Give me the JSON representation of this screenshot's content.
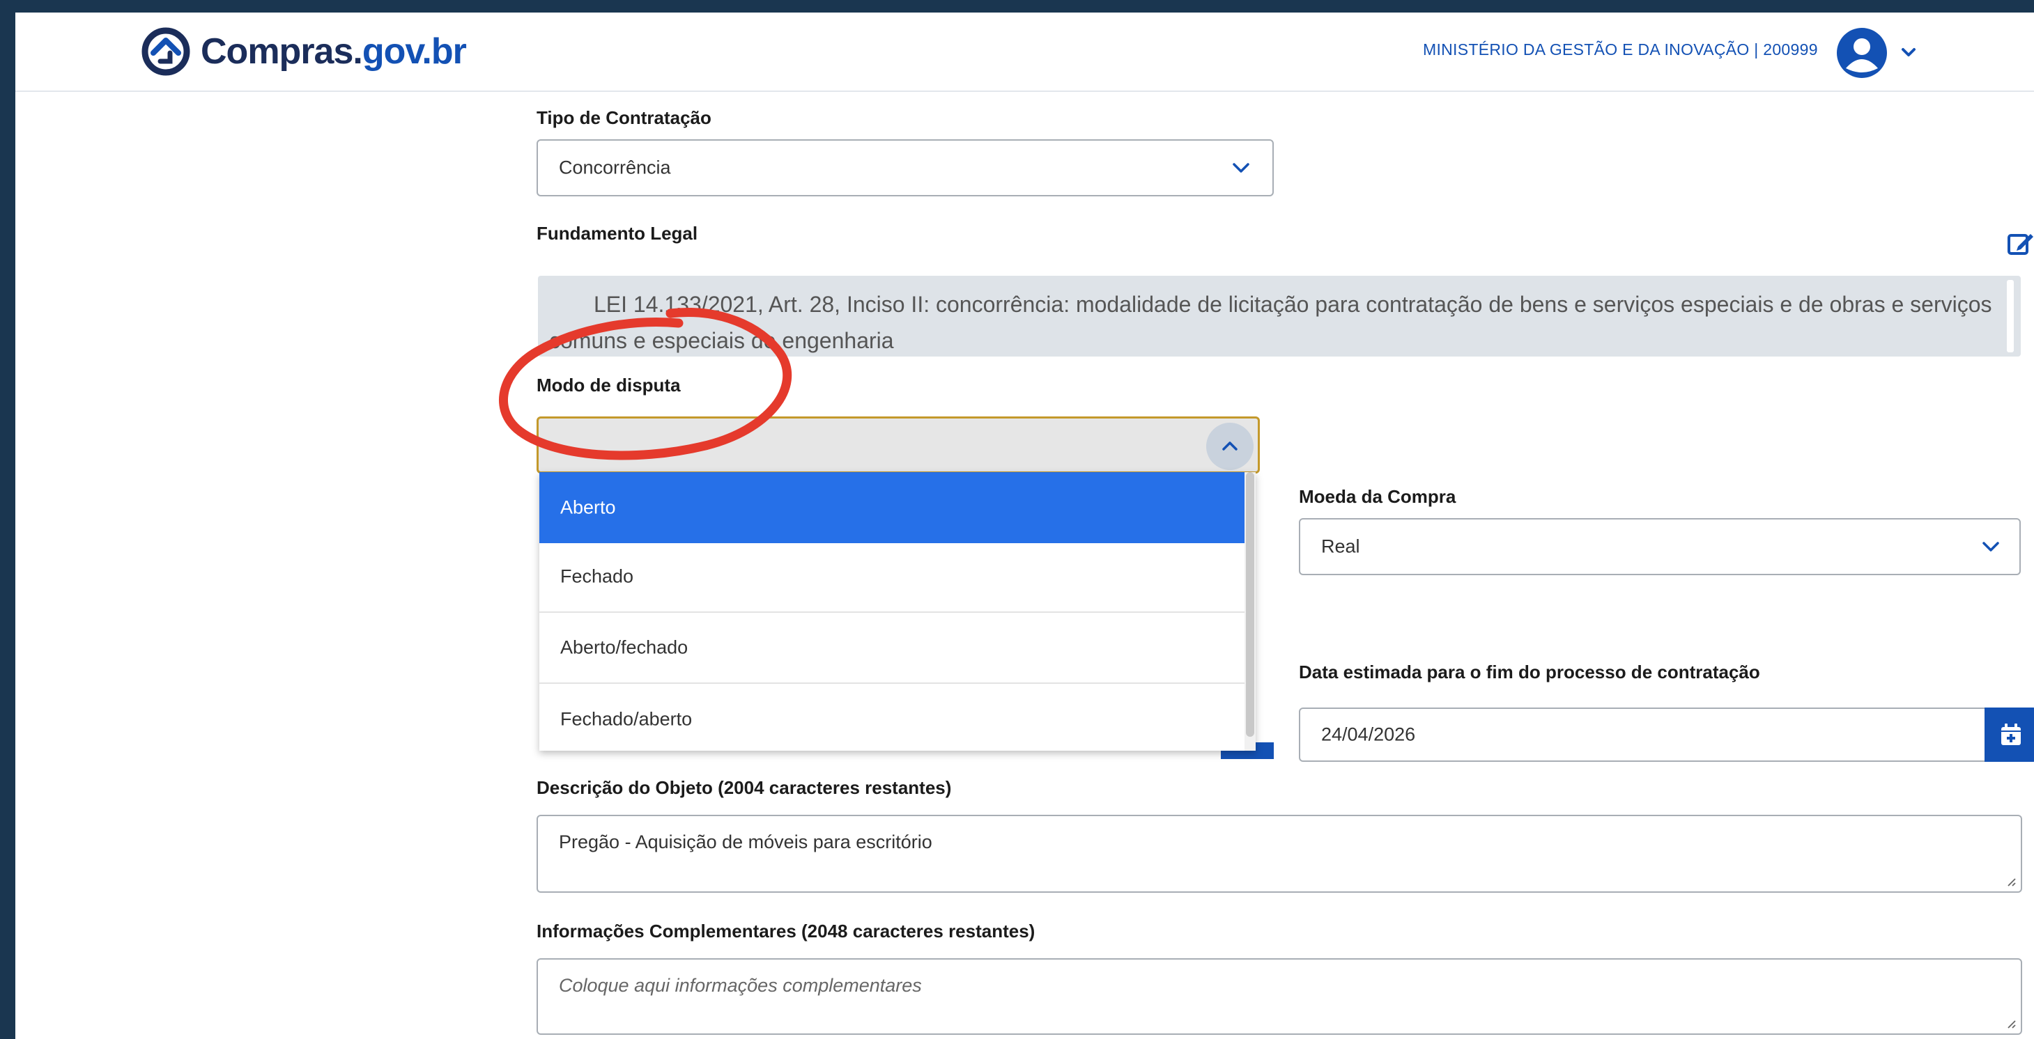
{
  "header": {
    "brand_part1": "Compras.",
    "brand_part2": "gov.br",
    "ministry": "MINISTÉRIO DA GESTÃO E DA INOVAÇÃO | 200999"
  },
  "form": {
    "tipo_contratacao": {
      "label": "Tipo de Contratação",
      "value": "Concorrência"
    },
    "fundamento_legal": {
      "label": "Fundamento Legal",
      "text": "LEI 14.133/2021, Art. 28, Inciso II: concorrência: modalidade de licitação para contratação de bens e serviços especiais e de obras e serviços comuns e especiais de engenharia"
    },
    "modo_disputa": {
      "label": "Modo de disputa",
      "value": "",
      "options": [
        "Aberto",
        "Fechado",
        "Aberto/fechado",
        "Fechado/aberto"
      ],
      "highlighted_option": "Aberto"
    },
    "moeda": {
      "label": "Moeda da Compra",
      "value": "Real"
    },
    "data_fim": {
      "label": "Data estimada para o fim do processo de contratação",
      "value": "24/04/2026"
    },
    "descricao": {
      "label": "Descrição do Objeto (2004 caracteres restantes)",
      "value": "Pregão - Aquisição de móveis para escritório"
    },
    "info_compl": {
      "label": "Informações Complementares (2048 caracteres restantes)",
      "placeholder": "Coloque aqui informações complementares"
    }
  },
  "icons": {
    "logo": "compras-logo-icon",
    "avatar": "user-avatar-icon",
    "edit": "edit-icon",
    "calendar": "calendar-icon",
    "chevron": "chevron-down-icon"
  },
  "colors": {
    "primary": "#1351b4",
    "highlight": "#2670e8",
    "annotation": "#e53a2c",
    "frame": "#1a3650",
    "focus_border": "#c4992b"
  }
}
